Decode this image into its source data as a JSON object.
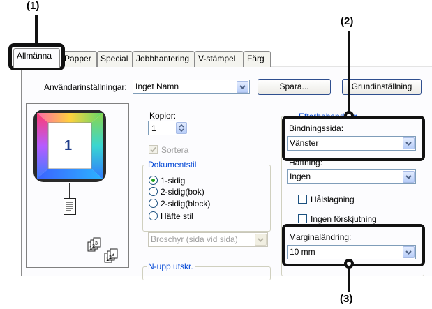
{
  "callouts": {
    "c1": "(1)",
    "c2": "(2)",
    "c3": "(3)"
  },
  "tabs": [
    "Allmänna",
    "Papper",
    "Special",
    "Jobbhantering",
    "V-stämpel",
    "Färg"
  ],
  "user_settings": {
    "label": "Användarinställningar:",
    "value": "Inget Namn",
    "save_label": "Spara...",
    "default_label": "Grundinställning"
  },
  "preview": {
    "page_number": "1"
  },
  "copies": {
    "label": "Kopior:",
    "value": "1"
  },
  "collate": {
    "label": "Sortera",
    "checked": true,
    "enabled": false
  },
  "document_style": {
    "title": "Dokumentstil",
    "options": [
      "1-sidig",
      "2-sidig(bok)",
      "2-sidig(block)",
      "Häfte stil"
    ],
    "selected": "1-sidig"
  },
  "booklet": {
    "value": "Broschyr (sida vid sida)",
    "enabled": false
  },
  "nup": {
    "title": "N-upp utskr."
  },
  "finishing": {
    "title": "Efterbehandling",
    "binding_label": "Bindningssida:",
    "binding_value": "Vänster",
    "stapling_label": "Häftning:",
    "stapling_value": "Ingen",
    "punch_label": "Hålslagning",
    "offset_label": "Ingen förskjutning"
  },
  "margin": {
    "label": "Marginaländring:",
    "value": "10 mm"
  },
  "colors": {
    "highlight": "#111111",
    "group_title": "#0046d5",
    "radio_dot": "#21a121"
  }
}
